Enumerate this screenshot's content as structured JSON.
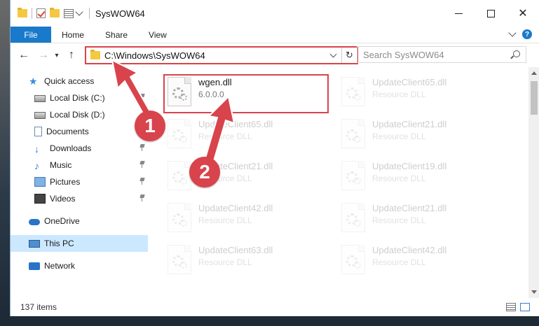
{
  "window": {
    "title": "SysWOW64"
  },
  "ribbon": {
    "tabs": [
      "File",
      "Home",
      "Share",
      "View"
    ]
  },
  "address": {
    "path": "C:\\Windows\\SysWOW64"
  },
  "search": {
    "placeholder": "Search SysWOW64"
  },
  "nav": {
    "items": [
      {
        "label": "Quick access",
        "icon": "star-icon"
      },
      {
        "label": "Local Disk (C:)",
        "icon": "disk-icon"
      },
      {
        "label": "Local Disk (D:)",
        "icon": "disk-icon"
      },
      {
        "label": "Documents",
        "icon": "documents-icon"
      },
      {
        "label": "Downloads",
        "icon": "download-icon"
      },
      {
        "label": "Music",
        "icon": "music-icon"
      },
      {
        "label": "Pictures",
        "icon": "pictures-icon"
      },
      {
        "label": "Videos",
        "icon": "videos-icon"
      },
      {
        "label": "OneDrive",
        "icon": "cloud-icon"
      },
      {
        "label": "This PC",
        "icon": "pc-icon"
      },
      {
        "label": "Network",
        "icon": "network-icon"
      }
    ]
  },
  "files": [
    {
      "name": "wgen.dll",
      "sub": "6.0.0.0"
    },
    {
      "name": "UpdateClient65.dll",
      "sub": "Resource DLL"
    },
    {
      "name": "UpdateClient65.dll",
      "sub": "Resource DLL"
    },
    {
      "name": "UpdateClient21.dll",
      "sub": "Resource DLL"
    },
    {
      "name": "UpdateClient21.dll",
      "sub": "Resource DLL"
    },
    {
      "name": "UpdateClient19.dll",
      "sub": "Resource DLL"
    },
    {
      "name": "UpdateClient42.dll",
      "sub": "Resource DLL"
    },
    {
      "name": "UpdateClient21.dll",
      "sub": "Resource DLL"
    },
    {
      "name": "UpdateClient63.dll",
      "sub": "Resource DLL"
    },
    {
      "name": "UpdateClient42.dll",
      "sub": "Resource DLL"
    }
  ],
  "status": {
    "item_count": "137 items"
  },
  "annotations": {
    "step1": "1",
    "step2": "2",
    "color": "#d9434b"
  }
}
